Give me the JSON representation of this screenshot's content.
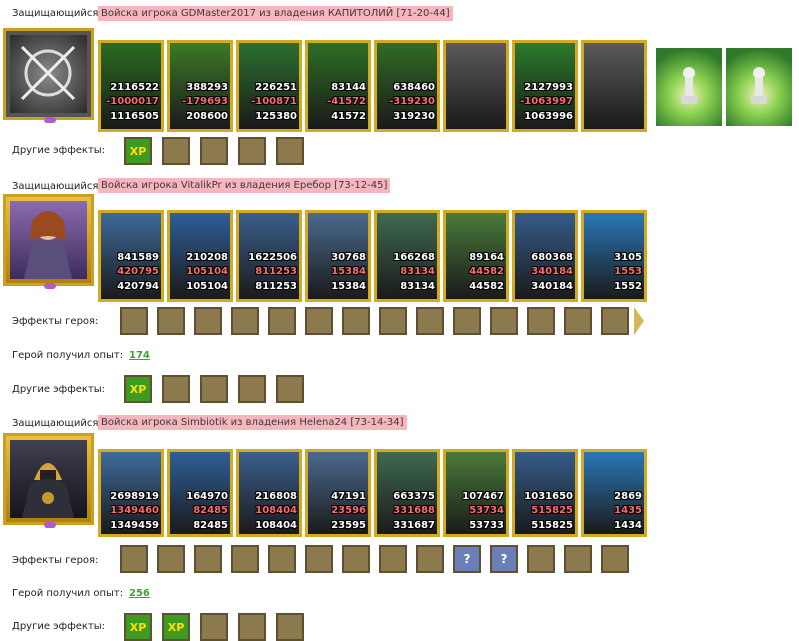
{
  "labels": {
    "defender": "Защищающийся",
    "other_effects": "Другие эффекты:",
    "hero_effects": "Эффекты героя:",
    "hero_got_exp": "Герой получил опыт:"
  },
  "sections": [
    {
      "banner": "Войска игрока GDMaster2017 из владения КАПИТОЛИЙ [71-20-44]",
      "units": [
        {
          "a": "2116522",
          "b": "-1000017",
          "c": "1116505",
          "color": "#2b6a20"
        },
        {
          "a": "388293",
          "b": "-179693",
          "c": "208600",
          "color": "#3b7a28"
        },
        {
          "a": "226251",
          "b": "-100871",
          "c": "125380",
          "color": "#2c7030"
        },
        {
          "a": "83144",
          "b": "-41572",
          "c": "41572",
          "color": "#2d6e24"
        },
        {
          "a": "638460",
          "b": "-319230",
          "c": "319230",
          "color": "#316b25"
        },
        {
          "a": "",
          "b": "",
          "c": "",
          "color": "#5a5a5a"
        },
        {
          "a": "2127993",
          "b": "-1063997",
          "c": "1063996",
          "color": "#2a7a2a"
        },
        {
          "a": "",
          "b": "",
          "c": "",
          "color": "#5a5a5a"
        }
      ],
      "other_effects": [
        {
          "icon": "xp-icon",
          "text": "XP"
        },
        {
          "icon": "boot-icon",
          "text": ""
        },
        {
          "icon": "boot-icon",
          "text": ""
        },
        {
          "icon": "sword-icon",
          "text": ""
        },
        {
          "icon": "sword-icon",
          "text": ""
        }
      ]
    },
    {
      "banner": "Войска игрока VitalikPr из владения Еребор [73-12-45]",
      "units": [
        {
          "a": "841589",
          "b": "420795",
          "c": "420794",
          "color": "#3d6b9a"
        },
        {
          "a": "210208",
          "b": "105104",
          "c": "105104",
          "color": "#2e5f98"
        },
        {
          "a": "1622506",
          "b": "811253",
          "c": "811253",
          "color": "#3a5f8c"
        },
        {
          "a": "30768",
          "b": "15384",
          "c": "15384",
          "color": "#4a6a8e"
        },
        {
          "a": "166268",
          "b": "83134",
          "c": "83134",
          "color": "#3f6a52"
        },
        {
          "a": "89164",
          "b": "44582",
          "c": "44582",
          "color": "#4a7a3a"
        },
        {
          "a": "680368",
          "b": "340184",
          "c": "340184",
          "color": "#355c8a"
        },
        {
          "a": "3105",
          "b": "1553",
          "c": "1552",
          "color": "#2a78b8"
        }
      ],
      "hero_effects": [
        "boot-dice-icon",
        "shield-icon",
        "hand-shield-icon",
        "sword-green-icon",
        "hand-sword-icon",
        "hand-sword2-icon",
        "helmet-icon",
        "armor-icon",
        "mask-icon",
        "ring-icon",
        "bow-icon",
        "sword-icon",
        "armor2-icon",
        "skull-icon"
      ],
      "exp": "174",
      "other_effects": [
        {
          "icon": "xp-icon",
          "text": "XP"
        },
        {
          "icon": "boot-icon",
          "text": ""
        },
        {
          "icon": "boot-icon",
          "text": ""
        },
        {
          "icon": "sword-icon",
          "text": ""
        },
        {
          "icon": "sword-icon",
          "text": ""
        }
      ]
    },
    {
      "banner": "Войска игрока Simbiotik из владения Helena24 [73-14-34]",
      "units": [
        {
          "a": "2698919",
          "b": "1349460",
          "c": "1349459",
          "color": "#3d6b9a"
        },
        {
          "a": "164970",
          "b": "82485",
          "c": "82485",
          "color": "#2e5f98"
        },
        {
          "a": "216808",
          "b": "108404",
          "c": "108404",
          "color": "#3a5f8c"
        },
        {
          "a": "47191",
          "b": "23596",
          "c": "23595",
          "color": "#4a6a8e"
        },
        {
          "a": "663375",
          "b": "331688",
          "c": "331687",
          "color": "#3f6a52"
        },
        {
          "a": "107467",
          "b": "53734",
          "c": "53733",
          "color": "#4a7a3a"
        },
        {
          "a": "1031650",
          "b": "515825",
          "c": "515825",
          "color": "#355c8a"
        },
        {
          "a": "2869",
          "b": "1435",
          "c": "1434",
          "color": "#2a78b8"
        }
      ],
      "hero_effects": [
        "boot-dice-icon",
        "shield-icon",
        "hand-shield-icon",
        "sword-green-icon",
        "hand-sword-icon",
        "hand-sword2-icon",
        "barrel-icon",
        "amulet-icon",
        "wings-icon",
        "question-icon",
        "question-icon",
        "chain-icon",
        "horn-icon",
        "staff-icon"
      ],
      "exp": "256",
      "other_effects": [
        {
          "icon": "xp-icon",
          "text": "XP"
        },
        {
          "icon": "xp-icon",
          "text": "XP"
        },
        {
          "icon": "boot-icon",
          "text": ""
        },
        {
          "icon": "sword-icon",
          "text": ""
        },
        {
          "icon": "sword-icon",
          "text": ""
        }
      ]
    }
  ]
}
